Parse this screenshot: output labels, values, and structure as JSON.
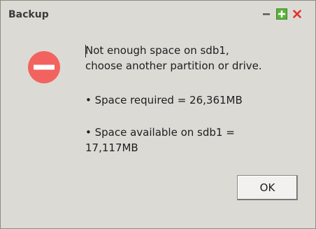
{
  "window": {
    "title": "Backup"
  },
  "titlebar_buttons": {
    "minimize_icon": "minimize-icon",
    "maximize_icon": "maximize-icon",
    "close_icon": "close-icon"
  },
  "dialog": {
    "icon": "stop-icon",
    "message_line1": "Not enough space on sdb1,",
    "message_line2": "choose another partition or drive.",
    "required_text": "•   Space required = 26,361MB",
    "available_text_line1": "•   Space available on sdb1 =",
    "available_text_line2": "17,117MB",
    "ok_label": "OK"
  },
  "colors": {
    "window_bg": "#dcdad5",
    "stop_icon_red": "#f2635f",
    "maximize_green": "#5bb33a",
    "close_red": "#e0322a"
  }
}
